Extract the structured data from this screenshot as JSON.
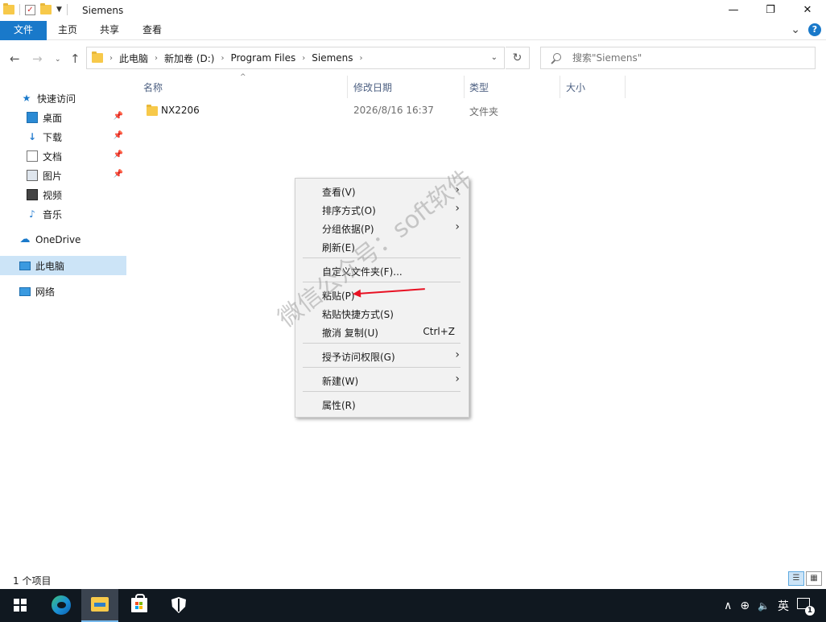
{
  "window": {
    "title": "Siemens",
    "controls": {
      "minimize": "—",
      "maximize": "❐",
      "close": "✕"
    }
  },
  "ribbon": {
    "tabs": [
      "文件",
      "主页",
      "共享",
      "查看"
    ],
    "collapse": "⌄",
    "help": "?"
  },
  "address": {
    "crumbs": [
      "此电脑",
      "新加卷 (D:)",
      "Program Files",
      "Siemens"
    ],
    "search_placeholder": "搜索\"Siemens\""
  },
  "sidebar": {
    "items": [
      {
        "label": "快速访问",
        "icon": "star-icon",
        "pinned": false
      },
      {
        "label": "桌面",
        "icon": "desktop-icon",
        "pinned": true
      },
      {
        "label": "下载",
        "icon": "download-icon",
        "pinned": true
      },
      {
        "label": "文档",
        "icon": "document-icon",
        "pinned": true
      },
      {
        "label": "图片",
        "icon": "picture-icon",
        "pinned": true
      },
      {
        "label": "视频",
        "icon": "video-icon",
        "pinned": false
      },
      {
        "label": "音乐",
        "icon": "music-icon",
        "pinned": false
      },
      {
        "label": "OneDrive",
        "icon": "cloud-icon",
        "pinned": false
      },
      {
        "label": "此电脑",
        "icon": "computer-icon",
        "pinned": false
      },
      {
        "label": "网络",
        "icon": "network-icon",
        "pinned": false
      }
    ]
  },
  "columns": {
    "name": "名称",
    "modified": "修改日期",
    "type": "类型",
    "size": "大小"
  },
  "files": [
    {
      "name": "NX2206",
      "modified": "2026/8/16 16:37",
      "type": "文件夹",
      "size": ""
    }
  ],
  "context_menu": {
    "view": "查看(V)",
    "sort": "排序方式(O)",
    "group": "分组依据(P)",
    "refresh": "刷新(E)",
    "customize": "自定义文件夹(F)...",
    "paste": "粘贴(P)",
    "paste_shortcut": "粘贴快捷方式(S)",
    "undo": "撤消 复制(U)",
    "undo_shortcut": "Ctrl+Z",
    "access": "授予访问权限(G)",
    "new": "新建(W)",
    "properties": "属性(R)"
  },
  "watermark": "微信公众号：soft软件",
  "status": {
    "item_count": "1 个项目"
  },
  "taskbar": {
    "tray": {
      "chevron": "∧",
      "network": "⊕",
      "volume": "🔈",
      "ime": "英",
      "notifications": "1"
    }
  },
  "colors": {
    "accent": "#1979ca",
    "selection": "#cce4f7",
    "arrow": "#e81123",
    "taskbar": "#101820"
  }
}
